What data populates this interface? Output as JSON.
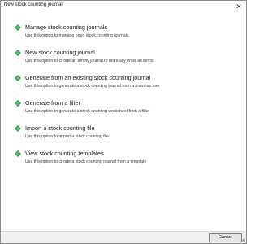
{
  "window": {
    "title": "New stock counting journal",
    "close_glyph": "✕"
  },
  "options": [
    {
      "label": "Manage stock counting journals",
      "description": "Use this option to manage open stock counting journals",
      "icon": "green-arrow-icon"
    },
    {
      "label": "New stock counting journal",
      "description": "Use this option to create an empty journal to manually enter all items",
      "icon": "green-arrow-icon"
    },
    {
      "label": "Generate from an existing stock counting journal",
      "description": "Use this option to generate a stock counting journal from a previous one",
      "icon": "green-arrow-icon"
    },
    {
      "label": "Generate from a filter",
      "description": "Use this option to generate a stock counting worksheet from a filter",
      "icon": "green-arrow-icon"
    },
    {
      "label": "Import a stock counting file",
      "description": "Use this option to import a stock counting file",
      "icon": "green-arrow-icon"
    },
    {
      "label": "View stock counting templates",
      "description": "Use this option to create a stock counting journal from a template",
      "icon": "green-arrow-icon"
    }
  ],
  "footer": {
    "cancel_label": "Cancel"
  },
  "colors": {
    "icon_green": "#2e9e4d"
  }
}
